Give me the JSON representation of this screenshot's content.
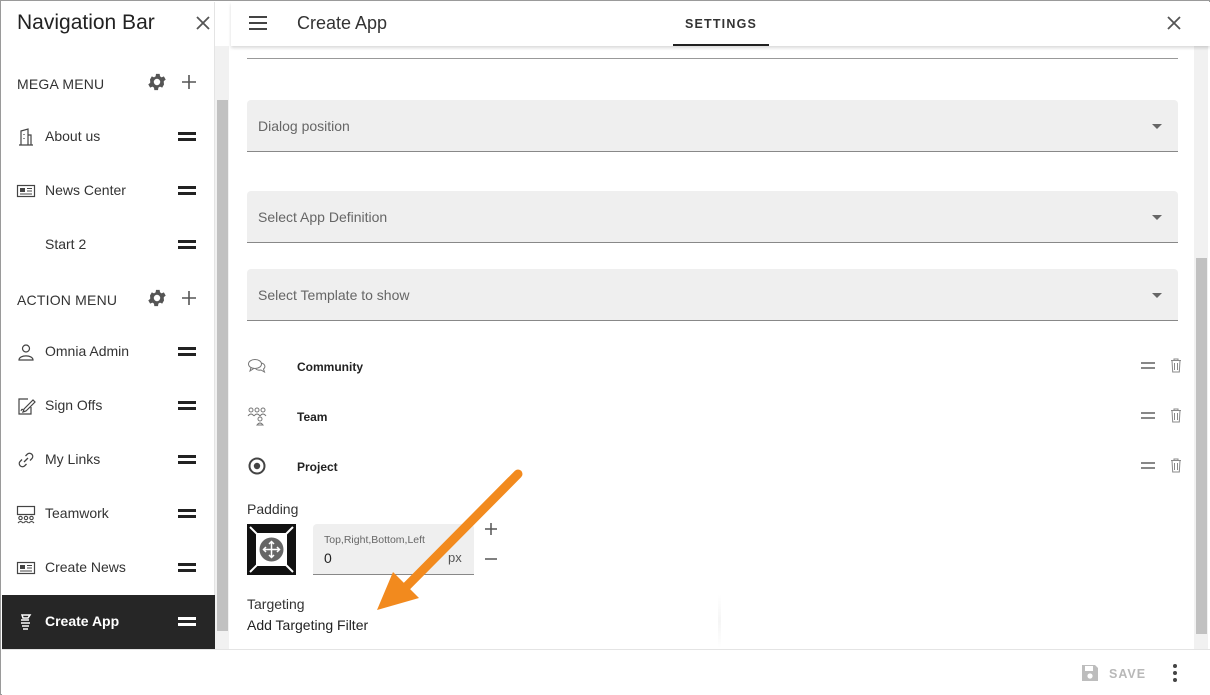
{
  "sidebar": {
    "title": "Navigation Bar",
    "sections": [
      {
        "label": "MEGA MENU"
      },
      {
        "label": "ACTION MENU"
      }
    ],
    "mega_items": [
      {
        "label": "About us",
        "icon": "building-icon"
      },
      {
        "label": "News Center",
        "icon": "newspaper-icon"
      },
      {
        "label": "Start 2",
        "icon": ""
      }
    ],
    "action_items": [
      {
        "label": "Omnia Admin",
        "icon": "person-icon"
      },
      {
        "label": "Sign Offs",
        "icon": "sign-document-icon"
      },
      {
        "label": "My Links",
        "icon": "link-icon"
      },
      {
        "label": "Teamwork",
        "icon": "teamwork-icon"
      },
      {
        "label": "Create News",
        "icon": "newspaper-icon"
      },
      {
        "label": "Create App",
        "icon": "create-app-icon",
        "active": true
      }
    ]
  },
  "main": {
    "title": "Create App",
    "tab": "SETTINGS",
    "selects": [
      {
        "label": "Dialog position"
      },
      {
        "label": "Select App Definition"
      },
      {
        "label": "Select Template to show"
      }
    ],
    "app_types": [
      {
        "label": "Community",
        "icon": "chat-bubbles-icon"
      },
      {
        "label": "Team",
        "icon": "team-icon"
      },
      {
        "label": "Project",
        "icon": "target-icon"
      }
    ],
    "padding": {
      "label": "Padding",
      "hint": "Top,Right,Bottom,Left",
      "value": "0",
      "unit": "px"
    },
    "targeting": {
      "label": "Targeting",
      "link": "Add Targeting Filter"
    }
  },
  "footer": {
    "save_label": "SAVE"
  },
  "colors": {
    "active_bg": "#262626",
    "arrow": "#f28a1e",
    "field_bg": "#efefef"
  }
}
